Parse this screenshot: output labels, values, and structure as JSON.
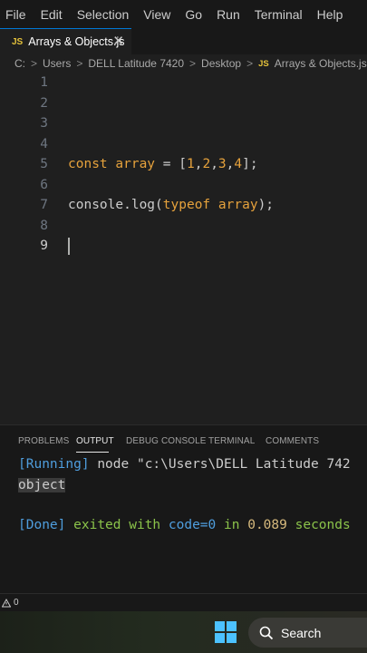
{
  "menu": [
    "File",
    "Edit",
    "Selection",
    "View",
    "Go",
    "Run",
    "Terminal",
    "Help"
  ],
  "tab": {
    "badge": "JS",
    "label": "Arrays & Objects.js",
    "close": "✕"
  },
  "breadcrumb": {
    "parts": [
      "C:",
      "Users",
      "DELL Latitude 7420",
      "Desktop"
    ],
    "file_badge": "JS",
    "file": "Arrays & Objects.js",
    "sep": ">",
    "more": "..."
  },
  "editor": {
    "line_numbers": [
      "1",
      "2",
      "3",
      "4",
      "5",
      "6",
      "7",
      "8",
      "9"
    ],
    "active_line": 9,
    "line5": {
      "kw": "const",
      "var": "array",
      "eq": "=",
      "open": "[",
      "n1": "1",
      "n2": "2",
      "n3": "3",
      "n4": "4",
      "comma": ",",
      "close": "];"
    },
    "line7": {
      "obj": "console",
      "dot": ".",
      "fn": "log",
      "open": "(",
      "kw": "typeof",
      "arg": "array",
      "close": ");"
    }
  },
  "panel": {
    "tabs": [
      "PROBLEMS",
      "OUTPUT",
      "DEBUG CONSOLE",
      "TERMINAL",
      "COMMENTS"
    ],
    "active_tab": "OUTPUT",
    "running_tag": "[Running]",
    "running_cmd": "node \"c:\\Users\\DELL Latitude 742",
    "result": "object",
    "done_tag": "[Done]",
    "done_text1": "exited with",
    "done_code": "code=0",
    "done_in": "in",
    "done_time": "0.089",
    "done_unit": "seconds"
  },
  "status": {
    "problems": "0"
  },
  "taskbar": {
    "search_label": "Search"
  },
  "colors": {
    "accent": "#0078d4",
    "js_badge": "#e5c23b",
    "string_orange": "#e6a23c",
    "output_blue": "#4f9ede",
    "output_green": "#8bc34a"
  }
}
